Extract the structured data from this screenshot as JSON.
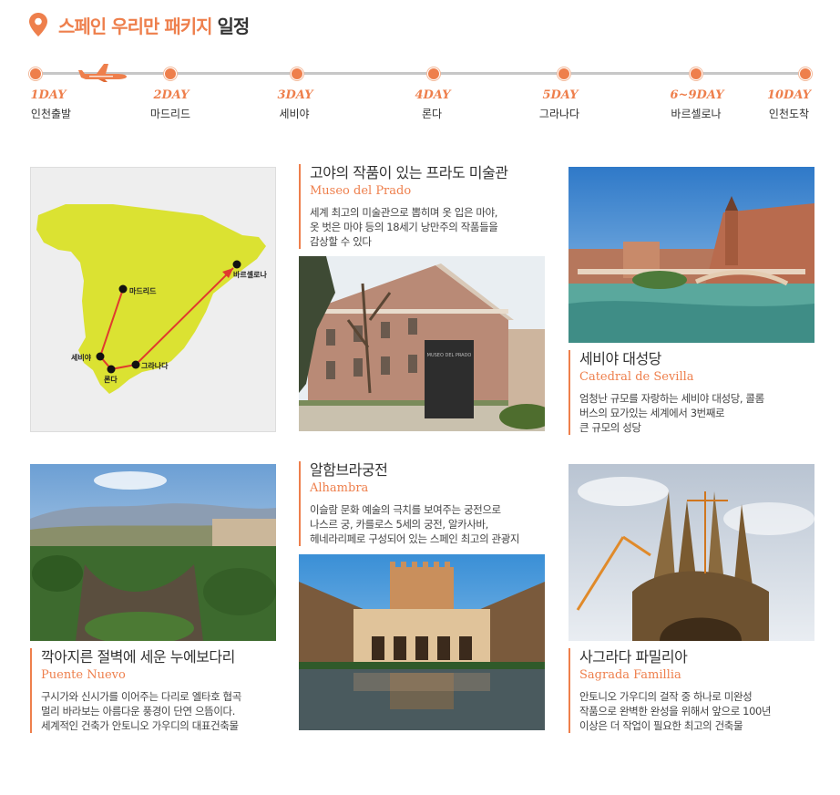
{
  "header": {
    "title_accent": "스페인 우리만 패키지",
    "title_rest": "일정"
  },
  "timeline": [
    {
      "day": "1DAY",
      "city": "인천출발"
    },
    {
      "day": "2DAY",
      "city": "마드리드"
    },
    {
      "day": "3DAY",
      "city": "세비야"
    },
    {
      "day": "4DAY",
      "city": "론다"
    },
    {
      "day": "5DAY",
      "city": "그라나다"
    },
    {
      "day": "6~9DAY",
      "city": "바르셀로나"
    },
    {
      "day": "10DAY",
      "city": "인천도착"
    }
  ],
  "map": {
    "labels": {
      "madrid": "마드리드",
      "sevilla": "세비야",
      "ronda": "론다",
      "granada": "그라나다",
      "barcelona": "바르셀로나"
    },
    "colors": {
      "land": "#dbe232",
      "route": "#e03a2e",
      "background": "#eeeeee"
    }
  },
  "cards": {
    "prado": {
      "title": "고야의 작품이 있는 프라도 미술관",
      "subtitle": "Museo del Prado",
      "desc": [
        "세계 최고의 미술관으로 뽑히며 옷 입은 마야,",
        "옷 벗은 마야 등의 18세기 낭만주의 작품들을",
        "감상할 수 있다"
      ],
      "sign_text": "MUSEO DEL PRADO"
    },
    "sevilla": {
      "title": "세비야 대성당",
      "subtitle": "Catedral de Sevilla",
      "desc": [
        "엄청난 규모를 자랑하는 세비야 대성당, 콜롬",
        "버스의 묘가있는 세계에서 3번째로",
        "큰 규모의 성당"
      ]
    },
    "ronda": {
      "title": "깍아지른 절벽에 세운 누에보다리",
      "subtitle": "Puente Nuevo",
      "desc": [
        "구시가와 신시가를 이어주는 다리로 엘타호 협곡",
        "멀리 바라보는 아름다운 풍경이 단연 으뜸이다.",
        "세계적인 건축가 안토니오 가우디의 대표건축물"
      ]
    },
    "alhambra": {
      "title": "알함브라궁전",
      "subtitle": "Alhambra",
      "desc": [
        "이슬람 문화 예술의 극치를 보여주는 궁전으로",
        "나스르 궁, 카를로스 5세의 궁전, 알카사바,",
        "헤네라리페로 구성되어 있는 스페인 최고의 관광지"
      ]
    },
    "familia": {
      "title": "사그라다 파밀리아",
      "subtitle": "Sagrada Famillia",
      "desc": [
        "안토니오 가우디의 걸작 중 하나로 미완성",
        "작품으로 완벽한 완성을 위해서 앞으로 100년",
        "이상은 더 작업이 필요한 최고의 건축물"
      ]
    }
  },
  "colors": {
    "accent": "#ee7f4c",
    "text": "#333333",
    "line": "#c7c7c7"
  }
}
